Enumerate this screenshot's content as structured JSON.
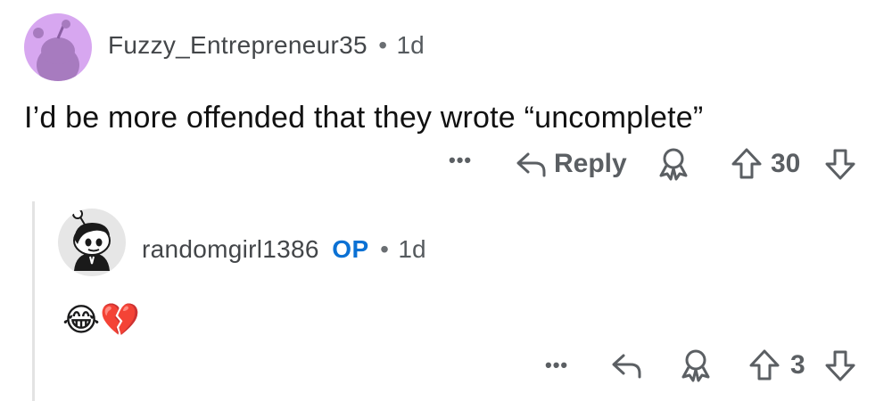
{
  "comment1": {
    "username": "Fuzzy_Entrepreneur35",
    "separator": "•",
    "age": "1d",
    "text": "I’d be more offended that they wrote “uncomplete”",
    "actions": {
      "more": "•••",
      "reply_label": "Reply",
      "score": "30"
    }
  },
  "comment2": {
    "username": "randomgirl1386",
    "op_badge": "OP",
    "separator": "•",
    "age": "1d",
    "text": "😂💔",
    "actions": {
      "more": "•••",
      "score": "3"
    }
  },
  "colors": {
    "op_badge": "#0b71d4",
    "avatar1_bg": "#d7a7f0",
    "icon_gray": "#5b5f63"
  },
  "icons": [
    "reply-icon",
    "award-icon",
    "upvote-icon",
    "downvote-icon",
    "more-icon"
  ]
}
